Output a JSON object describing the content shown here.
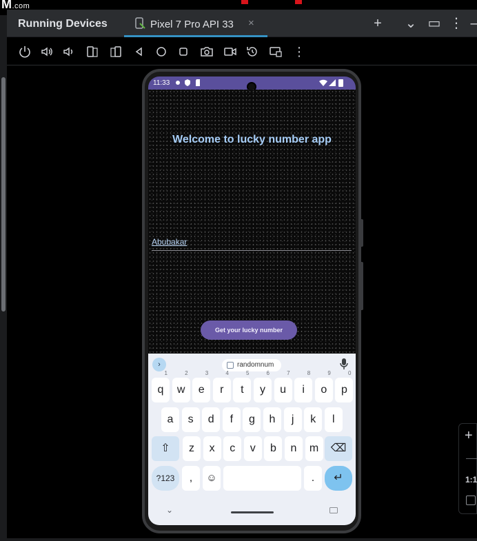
{
  "brand": {
    "text": "M",
    "suffix": ".com"
  },
  "panel": {
    "title": "Running Devices"
  },
  "tab": {
    "label": "Pixel 7 Pro API 33",
    "close_glyph": "×"
  },
  "tab_actions": [
    {
      "name": "add-device-icon",
      "glyph": "+"
    },
    {
      "name": "chevron-down-icon",
      "glyph": "⌄"
    },
    {
      "name": "window-icon",
      "glyph": "▭"
    },
    {
      "name": "more-vertical-icon",
      "glyph": "⋮"
    },
    {
      "name": "minimize-icon",
      "glyph": "–"
    }
  ],
  "toolbar": {
    "icons": [
      "power-icon",
      "volume-up-icon",
      "volume-down-icon",
      "rotate-left-icon",
      "rotate-right-icon",
      "back-icon",
      "home-icon",
      "overview-icon",
      "screenshot-icon",
      "screen-record-icon",
      "snapshot-restore-icon",
      "extended-controls-icon",
      "more-vertical-icon"
    ]
  },
  "status_bar": {
    "time": "11:33"
  },
  "app": {
    "welcome_text": "Welcome to lucky number app",
    "name_value": "Abubakar",
    "button_label": "Get your lucky number"
  },
  "keyboard": {
    "suggestion": "randomnum",
    "expand_glyph": "›",
    "rows": [
      [
        {
          "k": "q",
          "h": "1"
        },
        {
          "k": "w",
          "h": "2"
        },
        {
          "k": "e",
          "h": "3"
        },
        {
          "k": "r",
          "h": "4"
        },
        {
          "k": "t",
          "h": "5"
        },
        {
          "k": "y",
          "h": "6"
        },
        {
          "k": "u",
          "h": "7"
        },
        {
          "k": "i",
          "h": "8"
        },
        {
          "k": "o",
          "h": "9"
        },
        {
          "k": "p",
          "h": "0"
        }
      ],
      [
        {
          "k": "a"
        },
        {
          "k": "s"
        },
        {
          "k": "d"
        },
        {
          "k": "f"
        },
        {
          "k": "g"
        },
        {
          "k": "h"
        },
        {
          "k": "j"
        },
        {
          "k": "k"
        },
        {
          "k": "l"
        }
      ],
      [
        {
          "k": "z"
        },
        {
          "k": "x"
        },
        {
          "k": "c"
        },
        {
          "k": "v"
        },
        {
          "k": "b"
        },
        {
          "k": "n"
        },
        {
          "k": "m"
        }
      ]
    ],
    "symbols_label": "?123",
    "comma": ",",
    "period": ".",
    "shift_glyph": "⇧",
    "backspace_glyph": "⌫",
    "emoji_glyph": "☺",
    "enter_glyph": "↵",
    "nav_back_glyph": "⌄"
  },
  "right_panel": {
    "zoom_in": "+",
    "ratio": "1:1"
  },
  "colors": {
    "status_bar": "#5a4f9c",
    "welcome_text": "#a6cdf7",
    "button": "#6a5aa8",
    "tab_underline": "#3592c4",
    "record_indicator": "#d8141b"
  }
}
